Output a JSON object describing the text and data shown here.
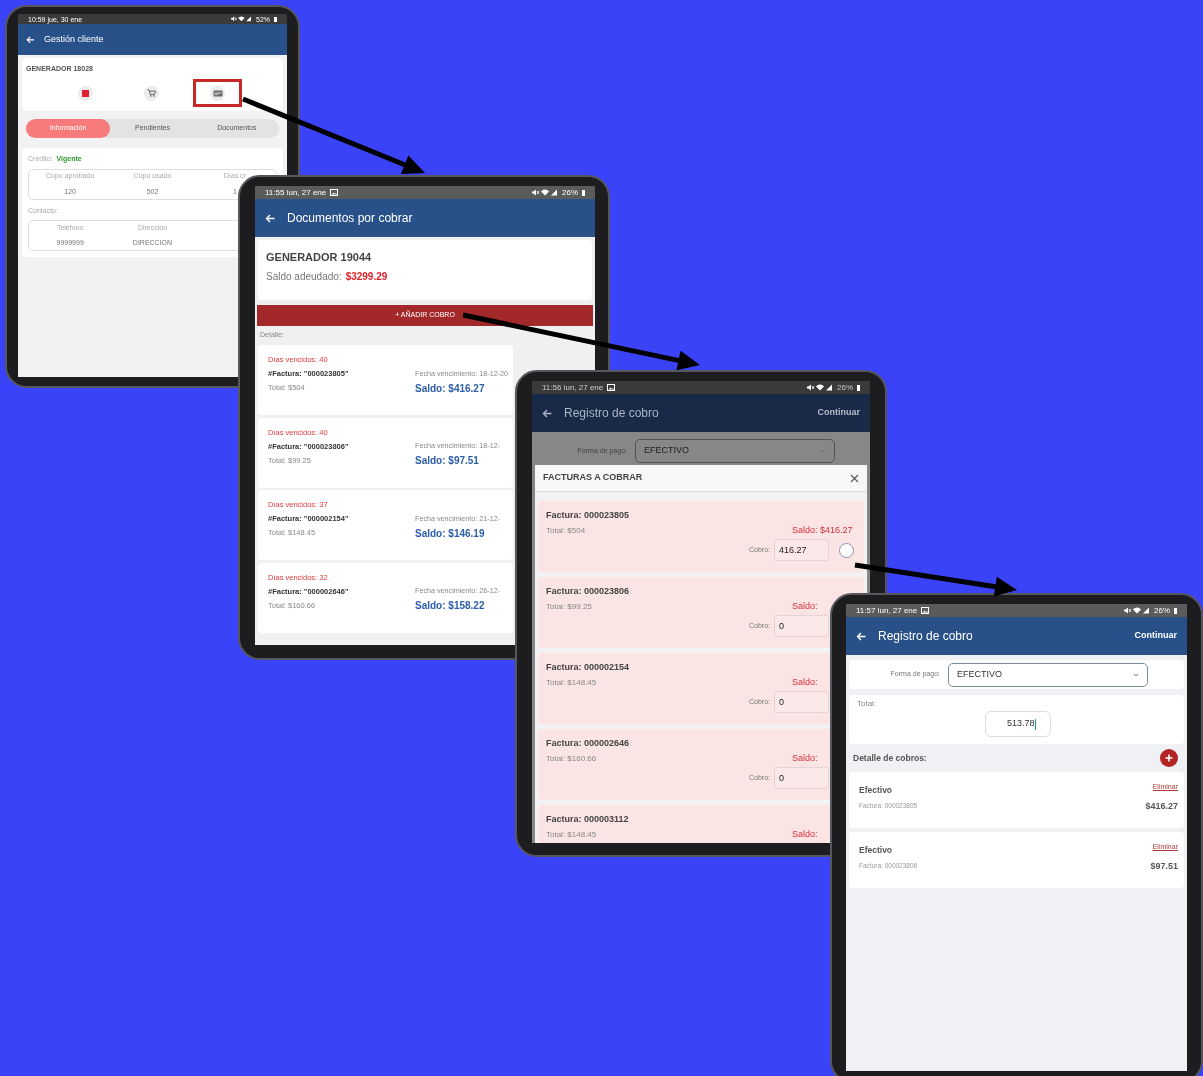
{
  "screens": [
    {
      "kind": "client_management",
      "status_bar": {
        "time": "10:59 jue, 30 ene",
        "battery": "52%"
      },
      "title": "Gestión cliente",
      "client_name": "GENERADOR 18028",
      "actions": [
        {
          "kind": "square",
          "highlighted": false
        },
        {
          "kind": "cart",
          "highlighted": false
        },
        {
          "kind": "card",
          "highlighted": true
        }
      ],
      "tabs": [
        {
          "label": "Información",
          "selected": true
        },
        {
          "label": "Pendientes",
          "selected": false
        },
        {
          "label": "Documentos",
          "selected": false
        }
      ],
      "credit_label": "Crédito:",
      "credit_status": "Vigente",
      "credit_stats": [
        {
          "label": "Cupo aprobado",
          "value": "120"
        },
        {
          "label": "Cupo usado",
          "value": "502"
        },
        {
          "label": "Días cr",
          "value": "1"
        }
      ],
      "contact_label": "Contacto:",
      "contact_fields": [
        {
          "label": "Teléfono",
          "value": "9999999"
        },
        {
          "label": "Dirección",
          "value": "DIRECCION"
        }
      ]
    },
    {
      "kind": "documents",
      "status_bar": {
        "time": "11:55 lun, 27 ene",
        "battery": "26%"
      },
      "title": "Documentos por cobrar",
      "client_name": "GENERADOR 19044",
      "balance_label": "Saldo adeudado:",
      "balance": "$3299.29",
      "add_button": "+ AÑADIR COBRO",
      "detail_label": "Detalle:",
      "documents": [
        {
          "days_overdue": "Días vencidos: 40",
          "invoice": "#Factura: \"000023805\"",
          "total": "Total: $504",
          "due_date": "Fecha vencimiento: 18-12-20",
          "balance": "Saldo: $416.27"
        },
        {
          "days_overdue": "Días vencidos: 40",
          "invoice": "#Factura: \"000023806\"",
          "total": "Total: $99.25",
          "due_date": "Fecha vencimiento: 18-12-",
          "balance": "Saldo: $97.51"
        },
        {
          "days_overdue": "Días vencidos: 37",
          "invoice": "#Factura: \"000002154\"",
          "total": "Total: $148.45",
          "due_date": "Fecha vencimiento: 21-12-",
          "balance": "Saldo: $146.19"
        },
        {
          "days_overdue": "Días vencidos: 32",
          "invoice": "#Factura: \"000002646\"",
          "total": "Total: $160.66",
          "due_date": "Fecha vencimiento: 26-12-",
          "balance": "Saldo: $158.22"
        }
      ]
    },
    {
      "kind": "payment_modal",
      "status_bar": {
        "time": "11:56 lun, 27 ene",
        "battery": "26%"
      },
      "title": "Registro de cobro",
      "action": "Continuar",
      "payment_label": "Forma de pago:",
      "payment_method": "EFECTIVO",
      "modal": {
        "title": "FACTURAS A COBRAR",
        "invoices": [
          {
            "invoice": "Factura: 000023805",
            "total": "Total: $504",
            "balance": "Saldo: $416.27",
            "payment_label": "Cobro:",
            "payment": "416.27",
            "selected": false
          },
          {
            "invoice": "Factura: 000023806",
            "total": "Total: $99.25",
            "balance": "Saldo:",
            "payment_label": "Cobro:",
            "payment": "0"
          },
          {
            "invoice": "Factura: 000002154",
            "total": "Total: $148.45",
            "balance": "Saldo:",
            "payment_label": "Cobro:",
            "payment": "0"
          },
          {
            "invoice": "Factura: 000002646",
            "total": "Total: $160.66",
            "balance": "Saldo:",
            "payment_label": "Cobro:",
            "payment": "0"
          },
          {
            "invoice": "Factura: 000003112",
            "total": "Total: $148.45",
            "balance": "Saldo:"
          }
        ]
      }
    },
    {
      "kind": "payment_register",
      "status_bar": {
        "time": "11:57 lun, 27 ene",
        "battery": "26%"
      },
      "title": "Registro de cobro",
      "action": "Continuar",
      "payment_label": "Forma de pago:",
      "payment_method": "EFECTIVO",
      "total_label": "Total:",
      "total": "513.78",
      "detail_label": "Detalle de cobros:",
      "payments": [
        {
          "method": "Efectivo",
          "delete": "Eliminar",
          "invoice": "Factura: 000023805",
          "amount": "$416.27"
        },
        {
          "method": "Efectivo",
          "delete": "Eliminar",
          "invoice": "Factura: 000023806",
          "amount": "$97.51"
        }
      ]
    }
  ]
}
